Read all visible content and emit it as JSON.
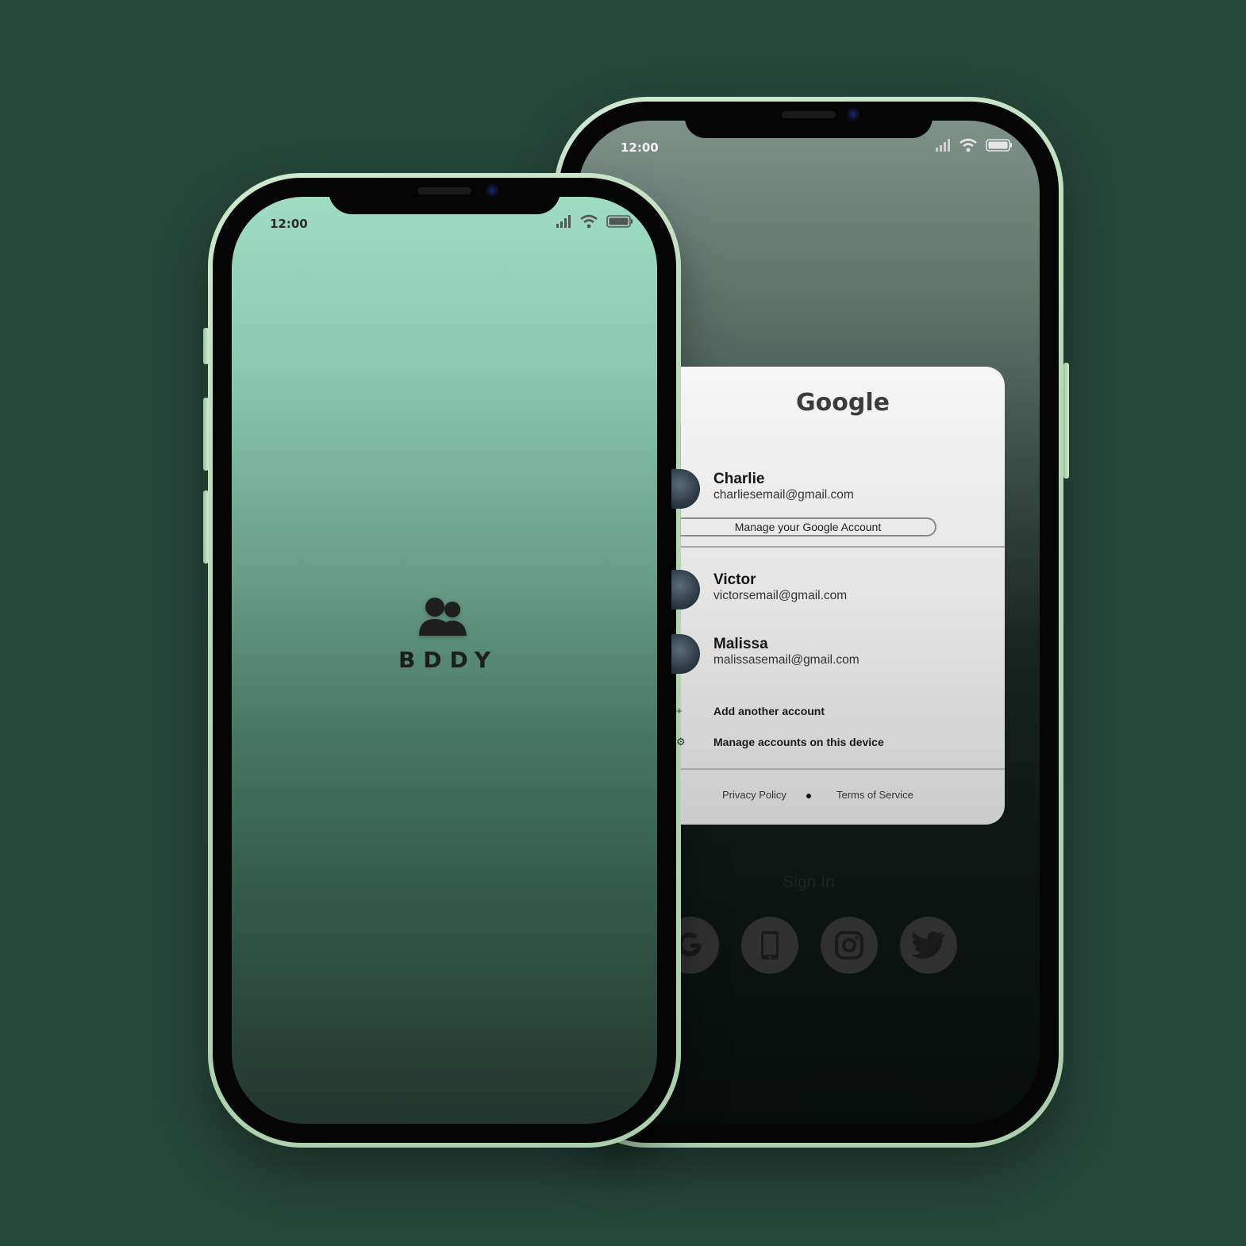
{
  "back_phone": {
    "status_time": "12:00",
    "dialog": {
      "title": "Google",
      "accounts": [
        {
          "name": "Charlie",
          "email": "charliesemail@gmail.com"
        },
        {
          "name": "Victor",
          "email": "victorsemail@gmail.com"
        },
        {
          "name": "Malissa",
          "email": "malissasemail@gmail.com"
        }
      ],
      "manage_account_label": "Manage your Google Account",
      "add_account_label": "Add another account",
      "manage_device_label": "Manage accounts on this device",
      "privacy_label": "Privacy Policy",
      "terms_label": "Terms of Service"
    },
    "sign_in_label": "Sign In",
    "social_buttons": [
      "google-icon",
      "phone-icon",
      "instagram-icon",
      "twitter-icon"
    ]
  },
  "front_phone": {
    "status_time": "12:00",
    "brand_icon": "users-icon",
    "brand_name": "BDDY"
  },
  "colors": {
    "background": "#26463a",
    "frame": "#b5d8b6",
    "accent_mint": "#9fdcc3"
  }
}
